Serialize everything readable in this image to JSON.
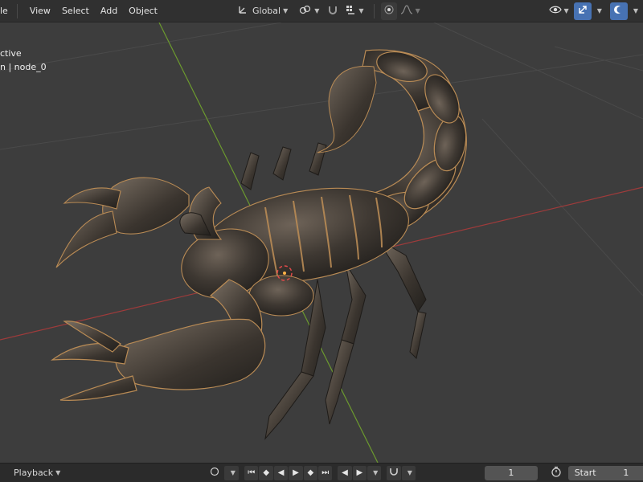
{
  "header": {
    "menu_partial": "le",
    "menus": [
      "View",
      "Select",
      "Add",
      "Object"
    ],
    "transform_orientation": "Global"
  },
  "viewport": {
    "overlay_line1": "ctive",
    "overlay_line2": "n | node_0",
    "object_icon": "scorpion-mesh",
    "axis_colors": {
      "x": "#b33a3a",
      "y": "#6c9a2e"
    }
  },
  "footer": {
    "playback_label": "Playback",
    "current_frame": "1",
    "start_label": "Start",
    "start_value": "1"
  },
  "colors": {
    "accent": "#4772b3",
    "header_bg": "#303030",
    "viewport_bg": "#3d3d3d"
  }
}
